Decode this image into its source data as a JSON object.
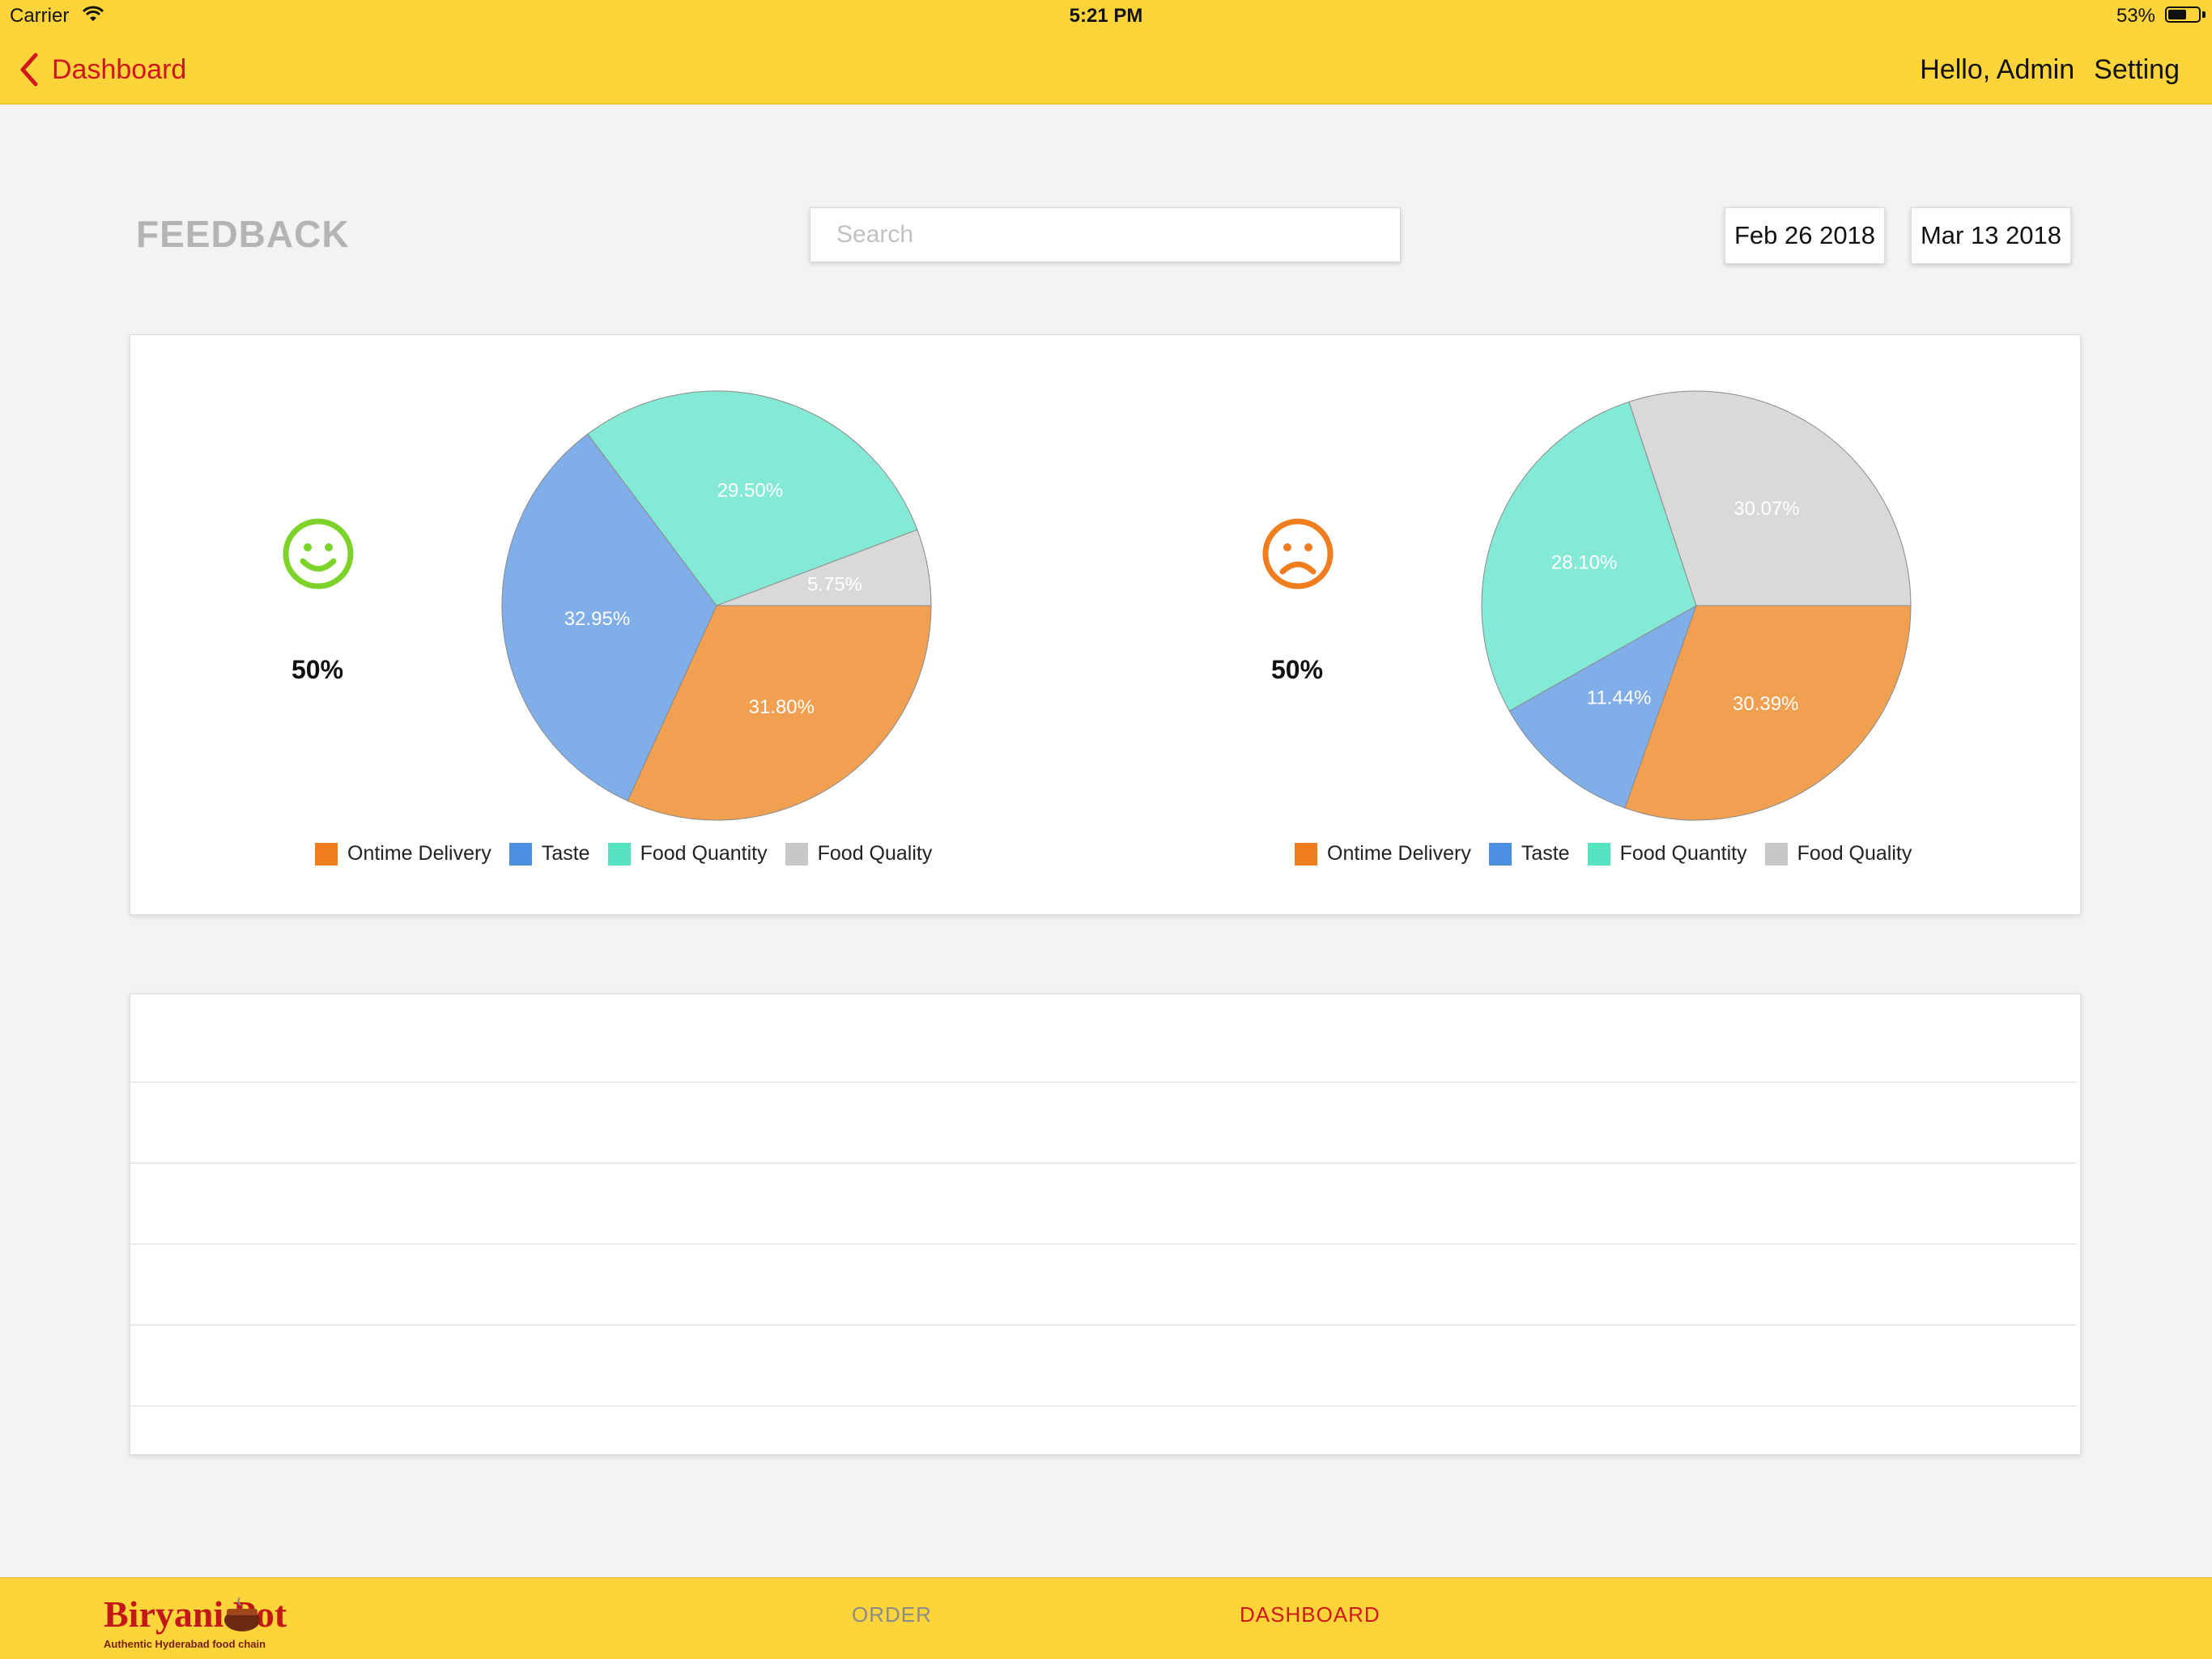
{
  "status_bar": {
    "carrier": "Carrier",
    "time": "5:21 PM",
    "battery": "53%",
    "battery_level": 0.53
  },
  "nav": {
    "back_label": "Dashboard",
    "greeting": "Hello, Admin",
    "setting_label": "Setting"
  },
  "page": {
    "title": "FEEDBACK"
  },
  "search": {
    "placeholder": "Search",
    "value": ""
  },
  "dates": {
    "from": "Feb 26 2018",
    "to": "Mar 13 2018"
  },
  "feedback": {
    "positive": {
      "icon": "smiley-face-icon",
      "color": "#7cd329",
      "percent": "50%"
    },
    "negative": {
      "icon": "sad-face-icon",
      "color": "#f07d1e",
      "percent": "50%"
    }
  },
  "legend": [
    {
      "label": "Ontime Delivery",
      "color": "#f07d1e"
    },
    {
      "label": "Taste",
      "color": "#4a8fe2"
    },
    {
      "label": "Food Quantity",
      "color": "#55e3c2"
    },
    {
      "label": "Food Quality",
      "color": "#c8c8c8"
    }
  ],
  "chart_data": [
    {
      "type": "pie",
      "categories": [
        "Ontime Delivery",
        "Taste",
        "Food Quantity",
        "Food Quality"
      ],
      "values": [
        31.8,
        32.95,
        29.5,
        5.75
      ],
      "labels": [
        "31.80%",
        "32.95%",
        "29.50%",
        "5.75%"
      ],
      "colors": [
        "#f0a050",
        "#80aee8",
        "#84ead5",
        "#d9d9d9"
      ],
      "legend_position": "bottom"
    },
    {
      "type": "pie",
      "categories": [
        "Ontime Delivery",
        "Taste",
        "Food Quantity",
        "Food Quality"
      ],
      "values": [
        30.39,
        11.44,
        28.1,
        30.07
      ],
      "labels": [
        "30.39%",
        "11.44%",
        "28.10%",
        "30.07%"
      ],
      "colors": [
        "#f0a050",
        "#80aee8",
        "#84ead5",
        "#d9d9d9"
      ],
      "legend_position": "bottom"
    }
  ],
  "list": {
    "rows": 6
  },
  "bottom_nav": {
    "logo_text": "Biryani Pot",
    "logo_tagline": "Authentic Hyderabad food chain",
    "tabs": [
      "ORDER",
      "DASHBOARD"
    ],
    "active_tab": "DASHBOARD"
  }
}
